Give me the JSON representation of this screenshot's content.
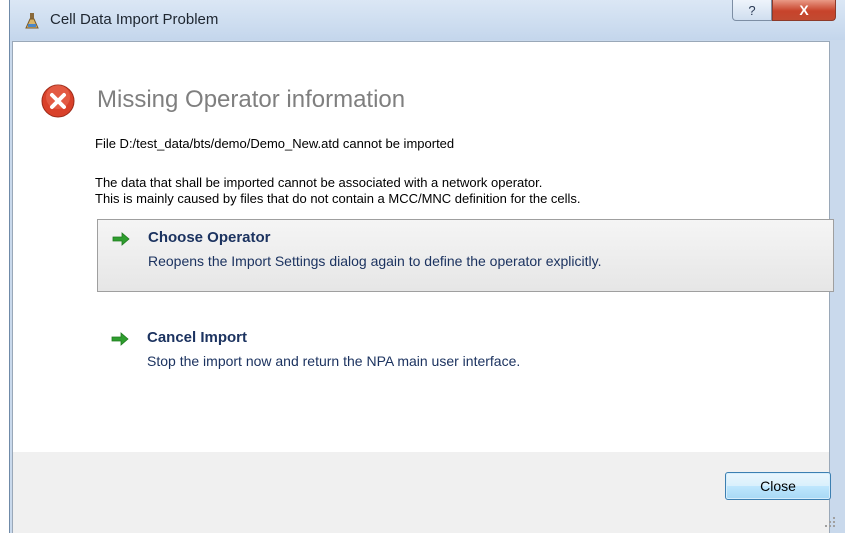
{
  "window": {
    "title": "Cell Data Import Problem",
    "help_label": "?",
    "close_label": "X"
  },
  "message": {
    "heading": "Missing Operator information",
    "file_line": "File D:/test_data/bts/demo/Demo_New.atd cannot be imported",
    "description_line1": "The data that shall be imported cannot be associated with a network operator.",
    "description_line2": "This is mainly caused by files that do not contain a MCC/MNC definition for the cells."
  },
  "commands": [
    {
      "label": "Choose Operator",
      "note": "Reopens the Import Settings dialog again to define the operator explicitly."
    },
    {
      "label": "Cancel Import",
      "note": "Stop the import now and return the NPA main user interface."
    }
  ],
  "footer": {
    "close_button_label": "Close"
  },
  "icons": {
    "app": "flask-icon",
    "error": "error-x-icon",
    "command_arrow": "green-arrow-icon",
    "resize": "resize-grip-icon"
  },
  "colors": {
    "error_red": "#d9412a",
    "arrow_green": "#2e9e2e",
    "command_text": "#1c3360",
    "heading_gray": "#7f7f7f"
  }
}
